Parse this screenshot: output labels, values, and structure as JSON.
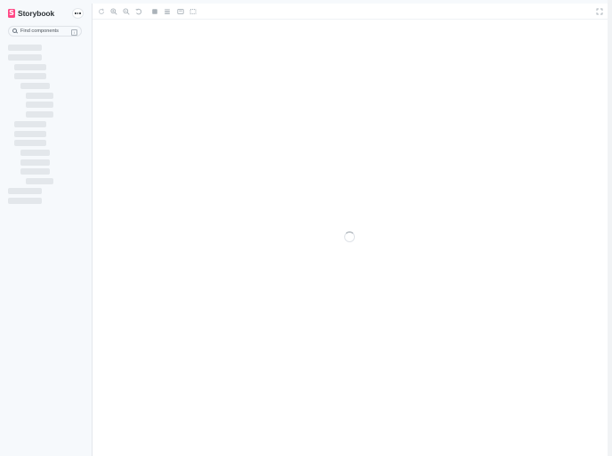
{
  "brand": {
    "logo_letter": "S",
    "name": "Storybook",
    "accent": "#ff4785"
  },
  "sidebar": {
    "menu_icon": "ellipsis-icon",
    "search": {
      "placeholder": "Find components",
      "shortcut": "/"
    },
    "loading_items": 17
  },
  "toolbar": {
    "icons": [
      "remount-icon",
      "zoom-in-icon",
      "zoom-out-icon",
      "zoom-reset-icon",
      "background-icon",
      "grid-icon",
      "viewport-icon",
      "outline-icon"
    ],
    "fullscreen_icon": "expand-icon"
  },
  "canvas": {
    "state": "loading",
    "spinner_icon": "spinner-icon"
  }
}
